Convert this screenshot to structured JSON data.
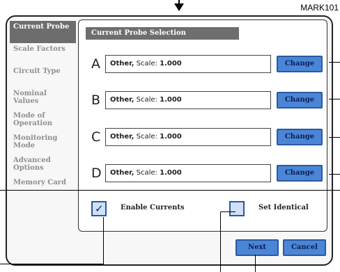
{
  "mark": "MARK101",
  "sidebar": {
    "items": [
      {
        "label": "Current Probe"
      },
      {
        "label": "Scale Factors"
      },
      {
        "label": "Circuit Type"
      },
      {
        "label": "Nominal Values"
      },
      {
        "label": "Mode of Operation"
      },
      {
        "label": "Monitoring Mode"
      },
      {
        "label": "Advanced Options"
      },
      {
        "label": "Memory Card"
      }
    ]
  },
  "panel": {
    "title": "Current Probe Selection",
    "rows": [
      {
        "channel": "A",
        "probe": "Other,",
        "scale_label": "Scale:",
        "scale_value": "1.000",
        "button": "Change"
      },
      {
        "channel": "B",
        "probe": "Other,",
        "scale_label": "Scale:",
        "scale_value": "1.000",
        "button": "Change"
      },
      {
        "channel": "C",
        "probe": "Other,",
        "scale_label": "Scale:",
        "scale_value": "1.000",
        "button": "Change"
      },
      {
        "channel": "D",
        "probe": "Other,",
        "scale_label": "Scale:",
        "scale_value": "1.000",
        "button": "Change"
      }
    ],
    "enable_currents": {
      "label": "Enable Currents",
      "checked": true
    },
    "set_identical": {
      "label": "Set Identical",
      "checked": false
    }
  },
  "footer": {
    "next": "Next",
    "cancel": "Cancel"
  }
}
